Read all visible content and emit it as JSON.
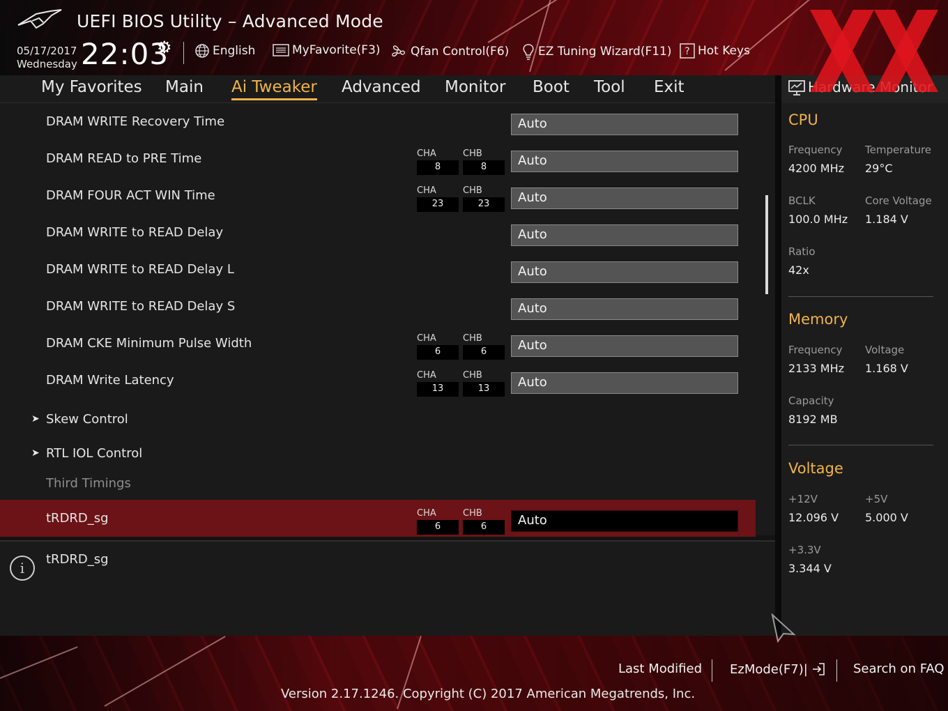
{
  "header": {
    "title": "UEFI BIOS Utility – Advanced Mode",
    "date": "05/17/2017",
    "weekday": "Wednesday",
    "time": "22:03",
    "tools": [
      {
        "label": "English",
        "icon": "globe-icon"
      },
      {
        "label": "MyFavorite(F3)",
        "icon": "list-icon"
      },
      {
        "label": "Qfan Control(F6)",
        "icon": "fan-icon"
      },
      {
        "label": "EZ Tuning Wizard(F11)",
        "icon": "lightbulb-icon"
      },
      {
        "label": "Hot Keys",
        "icon": "question-box-icon"
      }
    ]
  },
  "nav": {
    "tabs": [
      "My Favorites",
      "Main",
      "Ai Tweaker",
      "Advanced",
      "Monitor",
      "Boot",
      "Tool",
      "Exit"
    ],
    "active": "Ai Tweaker"
  },
  "settings": {
    "rows": [
      {
        "label": "DRAM WRITE Recovery Time",
        "value": "Auto"
      },
      {
        "label": "DRAM READ to PRE Time",
        "cha": "8",
        "chb": "8",
        "value": "Auto"
      },
      {
        "label": "DRAM FOUR ACT WIN Time",
        "cha": "23",
        "chb": "23",
        "value": "Auto"
      },
      {
        "label": "DRAM WRITE to READ Delay",
        "value": "Auto"
      },
      {
        "label": "DRAM WRITE to READ Delay L",
        "value": "Auto"
      },
      {
        "label": "DRAM WRITE to READ Delay S",
        "value": "Auto"
      },
      {
        "label": "DRAM CKE Minimum Pulse Width",
        "cha": "6",
        "chb": "6",
        "value": "Auto"
      },
      {
        "label": "DRAM Write Latency",
        "cha": "13",
        "chb": "13",
        "value": "Auto"
      }
    ],
    "channel_labels": {
      "a": "CHA",
      "b": "CHB"
    },
    "submenus": [
      "Skew Control",
      "RTL IOL Control"
    ],
    "section": "Third Timings",
    "selected": {
      "label": "tRDRD_sg",
      "cha": "6",
      "chb": "6",
      "value": "Auto"
    }
  },
  "help": {
    "text": "tRDRD_sg"
  },
  "hardware_monitor": {
    "title": "Hardware Monitor",
    "cpu": {
      "heading": "CPU",
      "frequency_label": "Frequency",
      "frequency": "4200 MHz",
      "temperature_label": "Temperature",
      "temperature": "29°C",
      "bclk_label": "BCLK",
      "bclk": "100.0 MHz",
      "core_voltage_label": "Core Voltage",
      "core_voltage": "1.184 V",
      "ratio_label": "Ratio",
      "ratio": "42x"
    },
    "memory": {
      "heading": "Memory",
      "frequency_label": "Frequency",
      "frequency": "2133 MHz",
      "voltage_label": "Voltage",
      "voltage": "1.168 V",
      "capacity_label": "Capacity",
      "capacity": "8192 MB"
    },
    "voltage": {
      "heading": "Voltage",
      "v12_label": "+12V",
      "v12": "12.096 V",
      "v5_label": "+5V",
      "v5": "5.000 V",
      "v33_label": "+3.3V",
      "v33": "3.344 V"
    }
  },
  "footer": {
    "last_modified": "Last Modified",
    "ezmode": "EzMode(F7)|",
    "search": "Search on FAQ",
    "version": "Version 2.17.1246. Copyright (C) 2017 American Megatrends, Inc."
  },
  "colors": {
    "accent": "#f0b449",
    "selected_row": "#6b1316",
    "watermark": "#e0141c"
  }
}
